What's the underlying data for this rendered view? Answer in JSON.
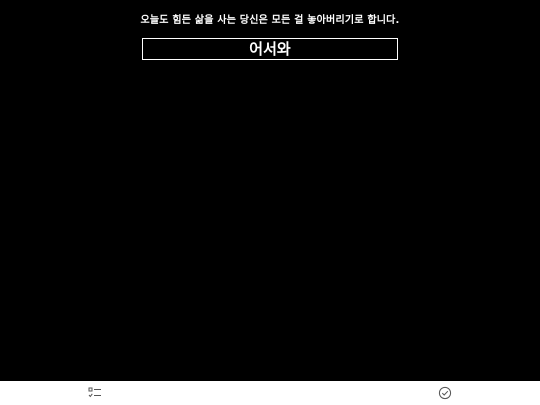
{
  "header": {
    "subtitle": "오늘도 힘든 삶을 사는 당신은 모든 걸 놓아버리기로 합니다.",
    "title": "어서와"
  },
  "bottom_bar": {
    "left_icon": "checklist-icon",
    "right_icon": "check-circle-icon"
  },
  "colors": {
    "background": "#000000",
    "foreground": "#ffffff",
    "bar": "#ffffff",
    "icon": "#555555"
  }
}
